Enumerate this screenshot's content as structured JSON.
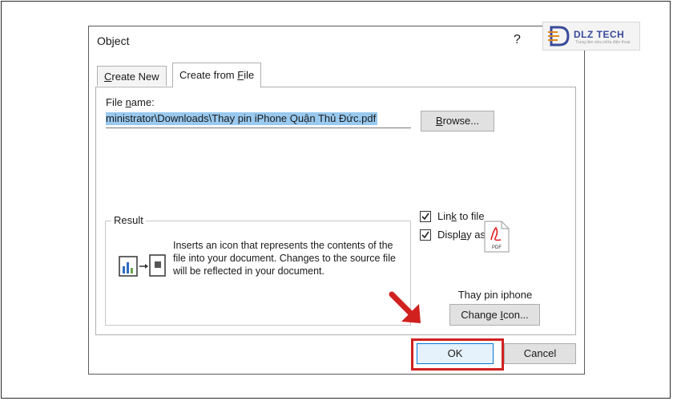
{
  "dialog": {
    "title": "Object",
    "help": "?",
    "logo": {
      "name": "DLZ TECH",
      "sub": "Trung tâm sửa chữa điện thoại"
    }
  },
  "tabs": [
    {
      "label_pre": "",
      "label_u": "C",
      "label_post": "reate New"
    },
    {
      "label_pre": "Create from ",
      "label_u": "F",
      "label_post": "ile"
    }
  ],
  "form": {
    "file_label_pre": "File ",
    "file_label_u": "n",
    "file_label_post": "ame:",
    "file_value": "ministrator\\Downloads\\Thay pin iPhone Quận Thủ Đức.pdf",
    "browse_pre": "",
    "browse_u": "B",
    "browse_post": "rowse..."
  },
  "options": {
    "link_pre": "Lin",
    "link_u": "k",
    "link_post": " to file",
    "link_checked": true,
    "display_pre": "Displ",
    "display_u": "a",
    "display_post": "y as icon",
    "display_checked": true
  },
  "result": {
    "legend": "Result",
    "text": "Inserts an icon that represents the contents of the file into your document.  Changes to the source file will be reflected in your document."
  },
  "icon_preview": {
    "badge": "PDF",
    "caption": "Thay pin iphone"
  },
  "change_icon": {
    "pre": "Change ",
    "u": "I",
    "post": "con..."
  },
  "buttons": {
    "ok": "OK",
    "cancel": "Cancel"
  },
  "colors": {
    "highlight": "#d0211f",
    "selection": "#99c9ef",
    "pdf_red": "#e02020",
    "logo_blue": "#3a4a9a"
  }
}
